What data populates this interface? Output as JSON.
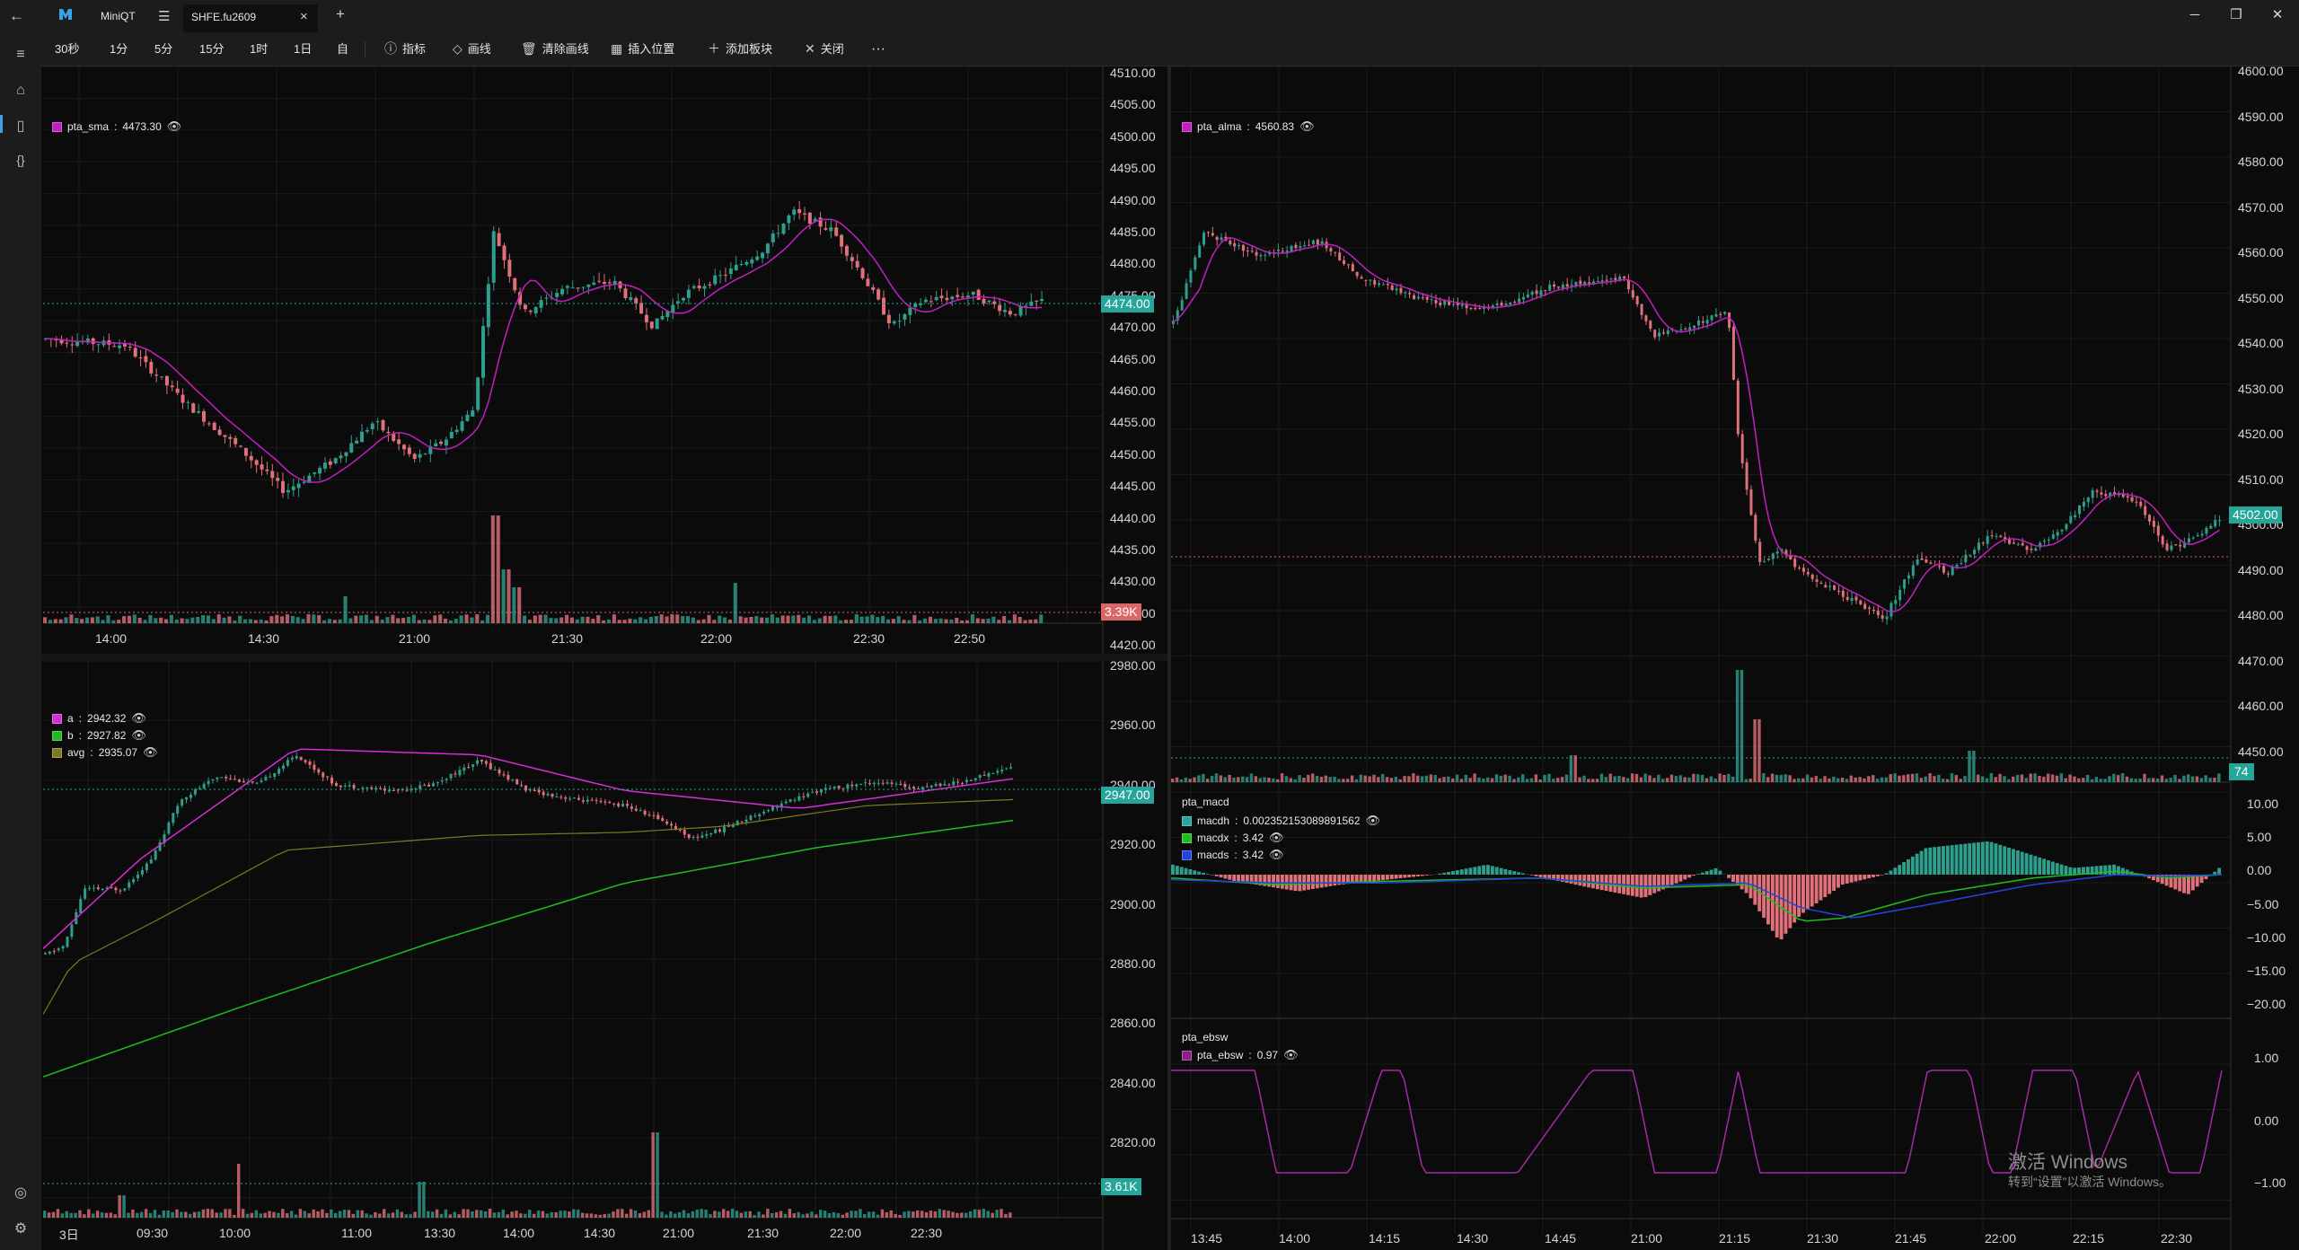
{
  "app": {
    "title": "MiniQT",
    "tab_label": "SHFE.fu2609",
    "tab_close": "×",
    "new_tab": "+",
    "colors": {
      "up": "#26a69a",
      "down": "#ef5350",
      "bg": "#0b0b0b",
      "panel": "#1c1c1c",
      "accent_green": "#26a69a",
      "accent_red": "#d9676a"
    }
  },
  "window": {
    "minimize": "─",
    "maximize": "❐",
    "close": "✕"
  },
  "sidebar": {
    "icons": [
      "back-arrow-icon",
      "menu-icon",
      "home-icon",
      "document-icon",
      "code-braces-icon",
      "globe-icon",
      "gear-icon"
    ]
  },
  "toolbar": {
    "periods": [
      "30秒",
      "1分",
      "5分",
      "15分",
      "1时",
      "1日",
      "自"
    ],
    "indicator_label": "指标",
    "draw_label": "画线",
    "clear_draw_label": "清除画线",
    "insert_pos_label": "插入位置",
    "add_block_label": "添加板块",
    "close_label": "关闭",
    "more": "···"
  },
  "panes": {
    "top_left": {
      "legend": {
        "name": "pta_sma",
        "value": "4473.30",
        "color": "#c21fc2"
      },
      "y_labels": [
        "4510.00",
        "4505.00",
        "4500.00",
        "4495.00",
        "4490.00",
        "4485.00",
        "4480.00",
        "4475.00",
        "4470.00",
        "4465.00",
        "4460.00",
        "4455.00",
        "4450.00",
        "4445.00",
        "4440.00",
        "4435.00",
        "4430.00",
        "4425.00",
        "4420.00"
      ],
      "x_labels": [
        "14:00",
        "14:30",
        "21:00",
        "21:30",
        "22:00",
        "22:30",
        "22:50"
      ],
      "price_tag": "4474.00",
      "volume_tag": "3.39K"
    },
    "bottom_left": {
      "legends": [
        {
          "name": "a",
          "value": "2942.32",
          "color": "#d52ed5"
        },
        {
          "name": "b",
          "value": "2927.82",
          "color": "#1fbd1f"
        },
        {
          "name": "avg",
          "value": "2935.07",
          "color": "#7d7a1f"
        }
      ],
      "y_labels": [
        "2980.00",
        "2960.00",
        "2940.00",
        "2920.00",
        "2900.00",
        "2880.00",
        "2860.00",
        "2840.00",
        "2820.00"
      ],
      "x_labels": [
        "3日",
        "09:30",
        "10:00",
        "11:00",
        "13:30",
        "14:00",
        "14:30",
        "21:00",
        "21:30",
        "22:00",
        "22:30"
      ],
      "price_tag": "2947.00",
      "volume_tag": "3.61K"
    },
    "right_main": {
      "legend": {
        "name": "pta_alma",
        "value": "4560.83",
        "color": "#c21fc2"
      },
      "y_labels": [
        "4600.00",
        "4590.00",
        "4580.00",
        "4570.00",
        "4560.00",
        "4550.00",
        "4540.00",
        "4530.00",
        "4520.00",
        "4510.00",
        "4500.00",
        "4490.00",
        "4480.00",
        "4470.00",
        "4460.00",
        "4450.00"
      ],
      "price_tag": "4502.00",
      "volume_tag": "74"
    },
    "right_macd": {
      "title": "pta_macd",
      "legends": [
        {
          "name": "macdh",
          "value": "0.002352153089891562",
          "color": "#26a69a"
        },
        {
          "name": "macdx",
          "value": "3.42",
          "color": "#1fbd1f"
        },
        {
          "name": "macds",
          "value": "3.42",
          "color": "#2244dd"
        }
      ],
      "y_labels": [
        "10.00",
        "5.00",
        "0.00",
        "−5.00",
        "−10.00",
        "−15.00",
        "−20.00"
      ]
    },
    "right_ebsw": {
      "title": "pta_ebsw",
      "legend": {
        "name": "pta_ebsw",
        "value": "0.97",
        "color": "#8a1f8a"
      },
      "y_labels": [
        "1.00",
        "0.00",
        "−1.00"
      ],
      "x_labels": [
        "13:45",
        "14:00",
        "14:15",
        "14:30",
        "14:45",
        "21:00",
        "21:15",
        "21:30",
        "21:45",
        "22:00",
        "22:15",
        "22:30"
      ]
    }
  },
  "watermark": {
    "line1": "激活 Windows",
    "line2": "转到“设置”以激活 Windows。"
  }
}
